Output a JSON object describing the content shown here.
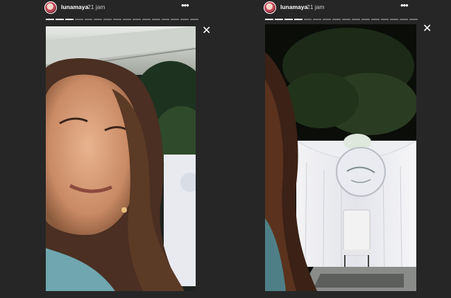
{
  "stories": [
    {
      "username": "lunamaya",
      "time": "21 jam",
      "more_icon": "•••",
      "close_icon": "✕",
      "progress": {
        "segments": 16,
        "completed": 3
      }
    },
    {
      "username": "lunamaya",
      "time": "21 jam",
      "more_icon": "•••",
      "close_icon": "✕",
      "progress": {
        "segments": 16,
        "completed": 4
      }
    }
  ]
}
